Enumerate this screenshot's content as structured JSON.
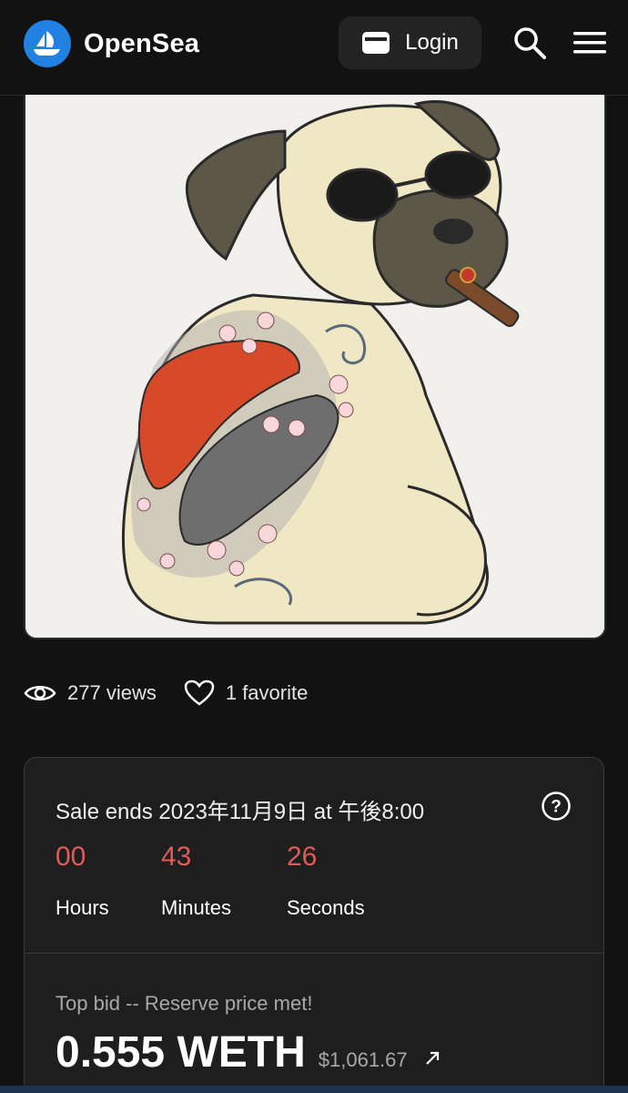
{
  "header": {
    "brand": "OpenSea",
    "logo_icon": "opensea-boat-icon",
    "login_label": "Login",
    "login_icon": "wallet-icon",
    "search_icon": "search-icon",
    "menu_icon": "hamburger-menu-icon"
  },
  "asset": {
    "image_icon": "pug-nft-artwork"
  },
  "stats": {
    "views": "277 views",
    "favorites": "1 favorite"
  },
  "sale": {
    "ends_text": "Sale ends 2023年11月9日 at 午後8:00",
    "countdown": [
      {
        "value": "00",
        "label": "Hours"
      },
      {
        "value": "43",
        "label": "Minutes"
      },
      {
        "value": "26",
        "label": "Seconds"
      }
    ],
    "top_bid_label": "Top bid -- Reserve price met!",
    "price": "0.555 WETH",
    "usd": "$1,061.67"
  },
  "colors": {
    "accent_blue": "#2081e2",
    "countdown_red": "#e05a5a",
    "background": "#121212"
  }
}
